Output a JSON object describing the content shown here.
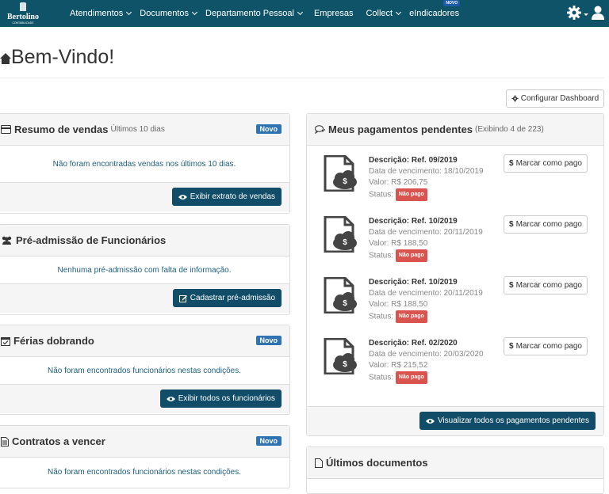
{
  "brand": {
    "name": "Bertolino",
    "sub": "CONTABILIDADE"
  },
  "nav": {
    "items": [
      {
        "label": "Atendimentos",
        "dropdown": true
      },
      {
        "label": "Documentos",
        "dropdown": true
      },
      {
        "label": "Departamento Pessoal",
        "dropdown": true
      },
      {
        "label": "Empresas",
        "dropdown": false
      },
      {
        "label": "Collect",
        "dropdown": true
      },
      {
        "label": "eIndicadores",
        "dropdown": false,
        "badge": "NOVO"
      }
    ]
  },
  "page": {
    "title": "Bem-Vindo!",
    "config_button": "Configurar Dashboard"
  },
  "panels": {
    "vendas": {
      "title": "Resumo de vendas",
      "subtitle": "Últimos 10 dias",
      "badge": "Novo",
      "message": "Não foram encontradas vendas nos últimos 10 dias.",
      "button": "Exibir extrato de vendas"
    },
    "preadmissao": {
      "title": "Pré-admissão de Funcionários",
      "message": "Nenhuma pré-admissão com falta de informação.",
      "button": "Cadastrar pré-admissão"
    },
    "ferias": {
      "title": "Férias dobrando",
      "badge": "Novo",
      "message": "Não foram encontrados funcionários nestas condições.",
      "button": "Exibir todos os funcionários"
    },
    "contratos": {
      "title": "Contratos a vencer",
      "badge": "Novo",
      "message": "Não foram encontrados funcionários nestas condições."
    },
    "pagamentos": {
      "title": "Meus pagamentos pendentes",
      "subtitle": "(Exibindo 4 de 223)",
      "button": "Visualizar todos os pagamentos pendentes",
      "mark_label": "Marcar como pago",
      "items": [
        {
          "desc": "Descrição: Ref. 09/2019",
          "due": "Data de vencimento: 18/10/2019",
          "value": "Valor: R$ 206,75",
          "status_label": "Status:",
          "status": "Não pago"
        },
        {
          "desc": "Descrição: Ref. 10/2019",
          "due": "Data de vencimento: 20/11/2019",
          "value": "Valor: R$ 188,50",
          "status_label": "Status:",
          "status": "Não pago"
        },
        {
          "desc": "Descrição: Ref. 10/2019",
          "due": "Data de vencimento: 20/11/2019",
          "value": "Valor: R$ 188,50",
          "status_label": "Status:",
          "status": "Não pago"
        },
        {
          "desc": "Descrição: Ref. 02/2020",
          "due": "Data de vencimento: 20/03/2020",
          "value": "Valor: R$ 215,52",
          "status_label": "Status:",
          "status": "Não pago"
        }
      ]
    },
    "documentos": {
      "title": "Últimos documentos"
    }
  },
  "colors": {
    "navbar": "#0f5369",
    "button_dark": "#114d68",
    "badge_new": "#2f73b3",
    "badge_red": "#d9534f"
  }
}
